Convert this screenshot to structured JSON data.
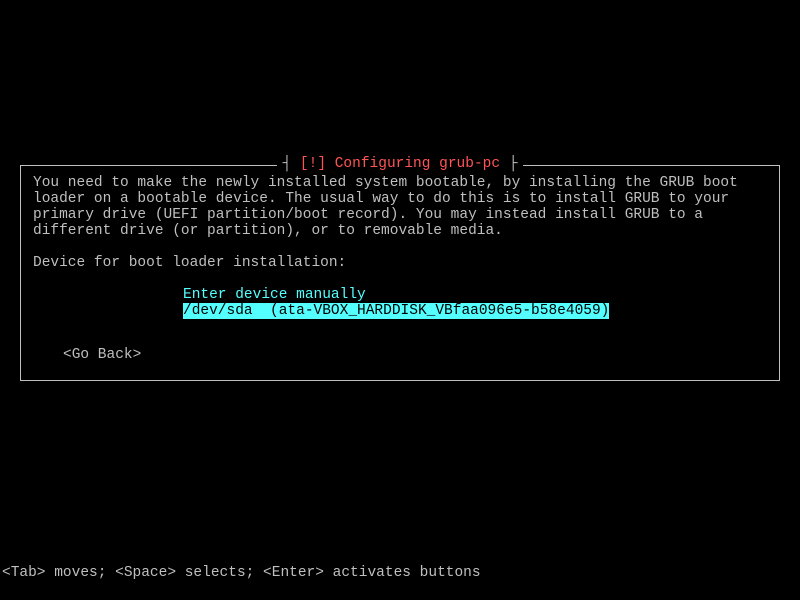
{
  "dialog": {
    "title_left_bracket": "┤ ",
    "title_flag": "[!]",
    "title_label": " Configuring grub-pc ",
    "title_right_bracket": "├",
    "body": "You need to make the newly installed system bootable, by installing the GRUB boot loader on a bootable device. The usual way to do this is to install GRUB to your primary drive (UEFI partition/boot record). You may instead install GRUB to a different drive (or partition), or to removable media.",
    "prompt": "Device for boot loader installation:",
    "options": {
      "manual": "Enter device manually",
      "device": "/dev/sda  (ata-VBOX_HARDDISK_VBfaa096e5-b58e4059)"
    },
    "go_back": "<Go Back>"
  },
  "footer": {
    "help": "<Tab> moves; <Space> selects; <Enter> activates buttons"
  }
}
